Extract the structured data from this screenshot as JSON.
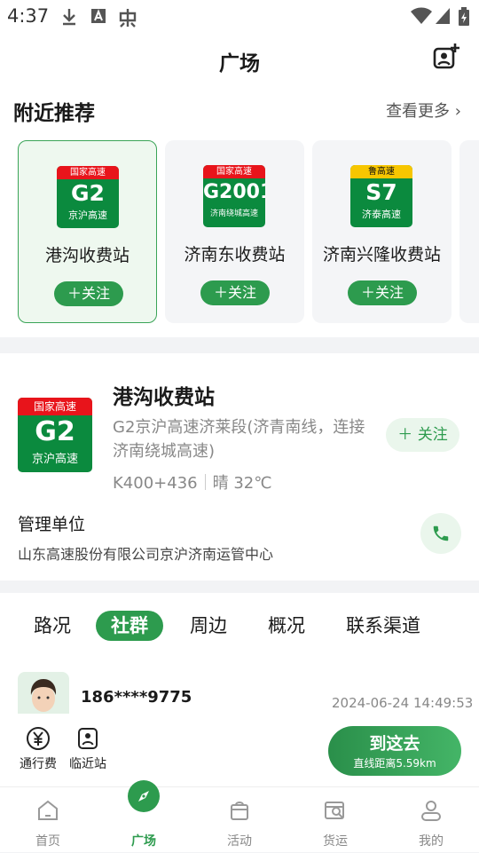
{
  "status_bar": {
    "time": "4:37"
  },
  "header": {
    "title": "广场"
  },
  "nearby": {
    "title": "附近推荐",
    "more": "查看更多",
    "cards": [
      {
        "name": "港沟收费站",
        "follow": "关注",
        "badge_top": "国家高速",
        "badge_code": "G2",
        "badge_sub": "京沪高速"
      },
      {
        "name": "济南东收费站",
        "follow": "关注",
        "badge_top": "国家高速",
        "badge_code": "G2001",
        "badge_sub": "济南绕城高速"
      },
      {
        "name": "济南兴隆收费站",
        "follow": "关注",
        "badge_top": "鲁高速",
        "badge_code": "S7",
        "badge_sub": "济泰高速"
      }
    ]
  },
  "detail": {
    "badge_top": "国家高速",
    "badge_code": "G2",
    "badge_sub": "京沪高速",
    "name": "港沟收费站",
    "route": "G2京沪高速济莱段(济青南线，连接济南绕城高速)",
    "km": "K400+436",
    "weather": "晴 32℃",
    "follow": "关注",
    "mgr_label": "管理单位",
    "mgr_value": "山东高速股份有限公司京沪济南运管中心"
  },
  "tabs": [
    "路况",
    "社群",
    "周边",
    "概况",
    "联系渠道"
  ],
  "active_tab": "社群",
  "post": {
    "user": "186****9775",
    "time": "2024-06-24 14:49:53"
  },
  "actions": {
    "toll": "通行费",
    "nearby_station": "临近站",
    "goto_main": "到这去",
    "goto_sub": "直线距离5.59km"
  },
  "bottom_nav": [
    {
      "label": "首页",
      "icon": "home-icon"
    },
    {
      "label": "广场",
      "icon": "compass-icon"
    },
    {
      "label": "活动",
      "icon": "gift-icon"
    },
    {
      "label": "货运",
      "icon": "truck-search-icon"
    },
    {
      "label": "我的",
      "icon": "person-icon"
    }
  ],
  "colors": {
    "accent": "#2d9b4e",
    "badge_red": "#e8141b",
    "badge_green": "#0b8a3e",
    "badge_yellow": "#f7c600"
  }
}
